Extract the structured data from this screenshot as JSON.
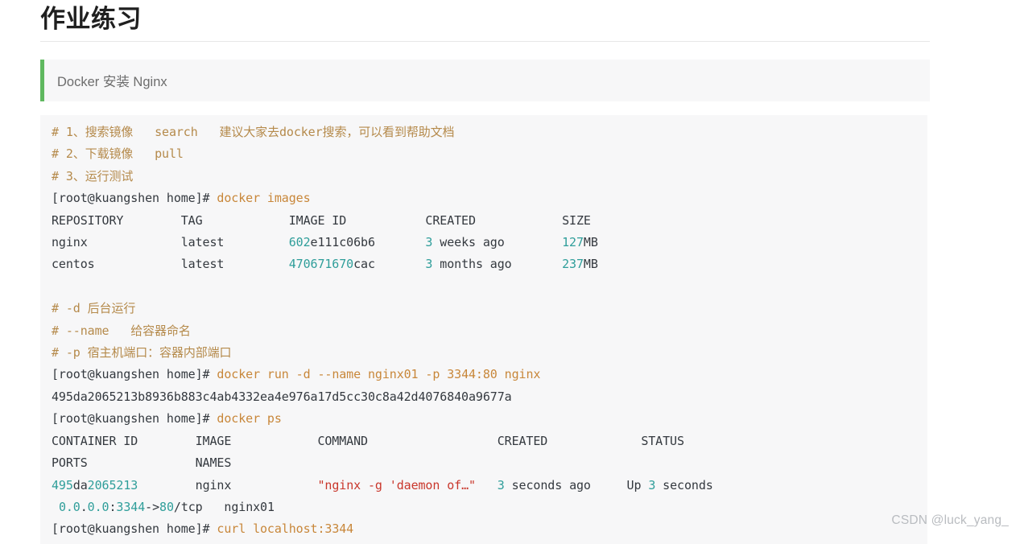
{
  "page": {
    "title": "作业练习",
    "watermark": "CSDN @luck_yang_"
  },
  "blockquote": {
    "text": "Docker 安装 Nginx",
    "border_color": "#5fb85f",
    "background": "#f7f7f8"
  },
  "code_block": {
    "background": "#f7f7f8",
    "colors": {
      "comment": "#b58a4b",
      "command": "#c8873a",
      "prompt": "#34393f",
      "number": "#2f9e9a",
      "string": "#c9372c",
      "plain": "#34393f"
    },
    "lines": [
      {
        "id": "l1",
        "segments": [
          {
            "cls": "cmt",
            "text": "# 1、搜索镜像   search   建议大家去docker搜索，可以看到帮助文档"
          }
        ]
      },
      {
        "id": "l2",
        "segments": [
          {
            "cls": "cmt",
            "text": "# 2、下载镜像   pull"
          }
        ]
      },
      {
        "id": "l3",
        "segments": [
          {
            "cls": "cmt",
            "text": "# 3、运行测试"
          }
        ]
      },
      {
        "id": "l4",
        "segments": [
          {
            "cls": "prompt",
            "text": "[root@kuangshen home]# "
          },
          {
            "cls": "cmd",
            "text": "docker images"
          }
        ]
      },
      {
        "id": "l5",
        "segments": [
          {
            "cls": "plain",
            "text": "REPOSITORY        TAG            IMAGE ID           CREATED            SIZE"
          }
        ]
      },
      {
        "id": "l6",
        "segments": [
          {
            "cls": "plain",
            "text": "nginx             latest         "
          },
          {
            "cls": "num",
            "text": "602"
          },
          {
            "cls": "plain",
            "text": "e111c06b6       "
          },
          {
            "cls": "num",
            "text": "3"
          },
          {
            "cls": "plain",
            "text": " weeks ago        "
          },
          {
            "cls": "num",
            "text": "127"
          },
          {
            "cls": "plain",
            "text": "MB"
          }
        ]
      },
      {
        "id": "l7",
        "segments": [
          {
            "cls": "plain",
            "text": "centos            latest         "
          },
          {
            "cls": "num",
            "text": "470671670"
          },
          {
            "cls": "plain",
            "text": "cac       "
          },
          {
            "cls": "num",
            "text": "3"
          },
          {
            "cls": "plain",
            "text": " months ago       "
          },
          {
            "cls": "num",
            "text": "237"
          },
          {
            "cls": "plain",
            "text": "MB"
          }
        ]
      },
      {
        "id": "l8",
        "segments": [
          {
            "cls": "blank",
            "text": " "
          }
        ]
      },
      {
        "id": "l9",
        "segments": [
          {
            "cls": "cmt",
            "text": "# -d 后台运行"
          }
        ]
      },
      {
        "id": "l10",
        "segments": [
          {
            "cls": "cmt",
            "text": "# --name   给容器命名"
          }
        ]
      },
      {
        "id": "l11",
        "segments": [
          {
            "cls": "cmt",
            "text": "# -p 宿主机端口：容器内部端口"
          }
        ]
      },
      {
        "id": "l12",
        "segments": [
          {
            "cls": "prompt",
            "text": "[root@kuangshen home]# "
          },
          {
            "cls": "cmd",
            "text": "docker run -d --name nginx01 -p 3344:80 nginx"
          }
        ]
      },
      {
        "id": "l13",
        "segments": [
          {
            "cls": "plain",
            "text": "495da2065213b8936b883c4ab4332ea4e976a17d5cc30c8a42d4076840a9677a"
          }
        ]
      },
      {
        "id": "l14",
        "segments": [
          {
            "cls": "prompt",
            "text": "[root@kuangshen home]# "
          },
          {
            "cls": "cmd",
            "text": "docker ps"
          }
        ]
      },
      {
        "id": "l15",
        "segments": [
          {
            "cls": "plain",
            "text": "CONTAINER ID        IMAGE            COMMAND                  CREATED             STATUS"
          }
        ]
      },
      {
        "id": "l16",
        "segments": [
          {
            "cls": "plain",
            "text": "PORTS               NAMES"
          }
        ]
      },
      {
        "id": "l17",
        "segments": [
          {
            "cls": "num",
            "text": "495"
          },
          {
            "cls": "plain",
            "text": "da"
          },
          {
            "cls": "num",
            "text": "2065213"
          },
          {
            "cls": "plain",
            "text": "        nginx            "
          },
          {
            "cls": "str",
            "text": "\"nginx -g 'daemon of…\""
          },
          {
            "cls": "plain",
            "text": "   "
          },
          {
            "cls": "num",
            "text": "3"
          },
          {
            "cls": "plain",
            "text": " seconds ago     Up "
          },
          {
            "cls": "num",
            "text": "3"
          },
          {
            "cls": "plain",
            "text": " seconds"
          }
        ]
      },
      {
        "id": "l18",
        "segments": [
          {
            "cls": "plain",
            "text": " "
          },
          {
            "cls": "num",
            "text": "0.0"
          },
          {
            "cls": "plain",
            "text": "."
          },
          {
            "cls": "num",
            "text": "0.0"
          },
          {
            "cls": "plain",
            "text": ":"
          },
          {
            "cls": "num",
            "text": "3344"
          },
          {
            "cls": "plain",
            "text": "->"
          },
          {
            "cls": "num",
            "text": "80"
          },
          {
            "cls": "plain",
            "text": "/tcp   nginx01"
          }
        ]
      },
      {
        "id": "l19",
        "segments": [
          {
            "cls": "prompt",
            "text": "[root@kuangshen home]# "
          },
          {
            "cls": "cmd",
            "text": "curl localhost:3344"
          }
        ]
      }
    ]
  }
}
